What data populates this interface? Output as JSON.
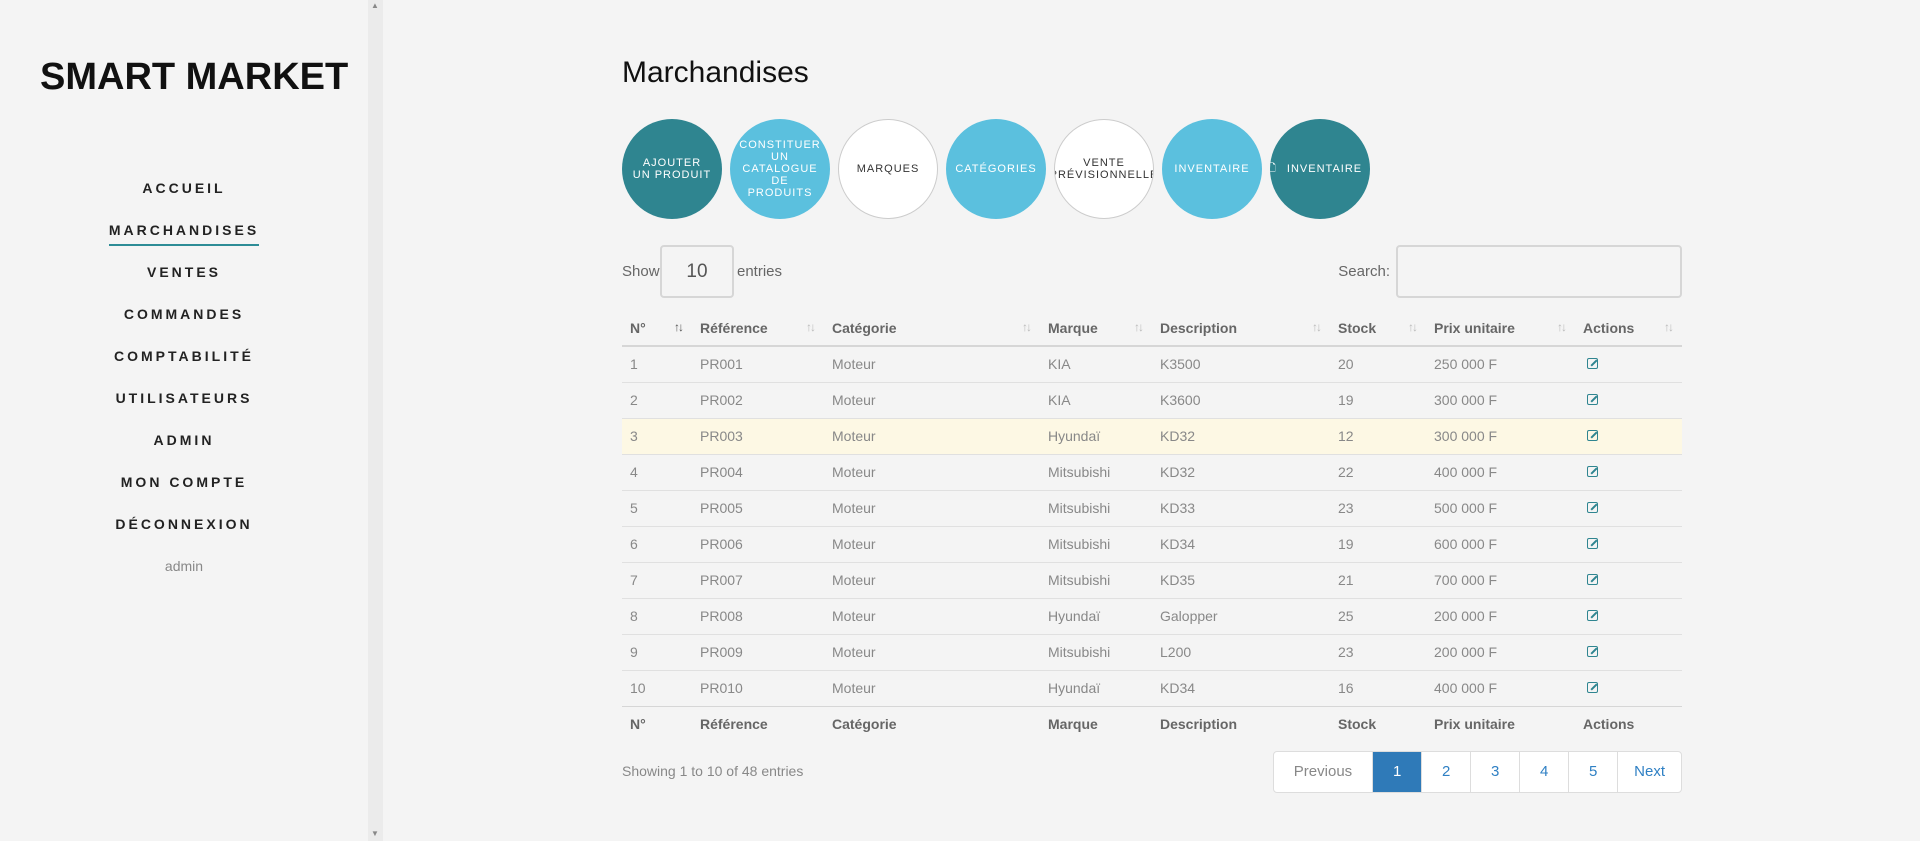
{
  "brand": "SMART MARKET",
  "nav": {
    "items": [
      "ACCUEIL",
      "MARCHANDISES",
      "VENTES",
      "COMMANDES",
      "COMPTABILITÉ",
      "UTILISATEURS",
      "ADMIN",
      "MON COMPTE",
      "DÉCONNEXION"
    ],
    "active": "MARCHANDISES",
    "user": "admin"
  },
  "page_title": "Marchandises",
  "actions": [
    {
      "label": "AJOUTER UN PRODUIT",
      "style": "dark"
    },
    {
      "label": "CONSTITUER UN CATALOGUE DE PRODUITS",
      "style": "light"
    },
    {
      "label": "MARQUES",
      "style": "white"
    },
    {
      "label": "CATÉGORIES",
      "style": "light"
    },
    {
      "label": "VENTE PRÉVISIONNELLE",
      "style": "white"
    },
    {
      "label": "INVENTAIRE",
      "style": "light"
    },
    {
      "label": "INVENTAIRE",
      "style": "dark",
      "icon": "file-icon"
    }
  ],
  "table_controls": {
    "show_label": "Show",
    "page_size": "10",
    "entries_label": "entries",
    "search_label": "Search:",
    "search_value": ""
  },
  "table": {
    "columns": [
      "N°",
      "Référence",
      "Catégorie",
      "Marque",
      "Description",
      "Stock",
      "Prix unitaire",
      "Actions"
    ],
    "rows": [
      [
        "1",
        "PR001",
        "Moteur",
        "KIA",
        "K3500",
        "20",
        "250 000 F"
      ],
      [
        "2",
        "PR002",
        "Moteur",
        "KIA",
        "K3600",
        "19",
        "300 000 F"
      ],
      [
        "3",
        "PR003",
        "Moteur",
        "Hyundaï",
        "KD32",
        "12",
        "300 000 F"
      ],
      [
        "4",
        "PR004",
        "Moteur",
        "Mitsubishi",
        "KD32",
        "22",
        "400 000 F"
      ],
      [
        "5",
        "PR005",
        "Moteur",
        "Mitsubishi",
        "KD33",
        "23",
        "500 000 F"
      ],
      [
        "6",
        "PR006",
        "Moteur",
        "Mitsubishi",
        "KD34",
        "19",
        "600 000 F"
      ],
      [
        "7",
        "PR007",
        "Moteur",
        "Mitsubishi",
        "KD35",
        "21",
        "700 000 F"
      ],
      [
        "8",
        "PR008",
        "Moteur",
        "Hyundaï",
        "Galopper",
        "25",
        "200 000 F"
      ],
      [
        "9",
        "PR009",
        "Moteur",
        "Mitsubishi",
        "L200",
        "23",
        "200 000 F"
      ],
      [
        "10",
        "PR010",
        "Moteur",
        "Hyundaï",
        "KD34",
        "16",
        "400 000 F"
      ]
    ],
    "highlighted_row": 3
  },
  "info": "Showing 1 to 10 of 48 entries",
  "pagination": {
    "items": [
      "Previous",
      "1",
      "2",
      "3",
      "4",
      "5",
      "Next"
    ],
    "active": "1"
  },
  "colors": {
    "accent_dark": "#2f8590",
    "accent_light": "#5bc0de",
    "pagination_active": "#2f7ab8",
    "row_highlight": "#fdf8e4"
  }
}
